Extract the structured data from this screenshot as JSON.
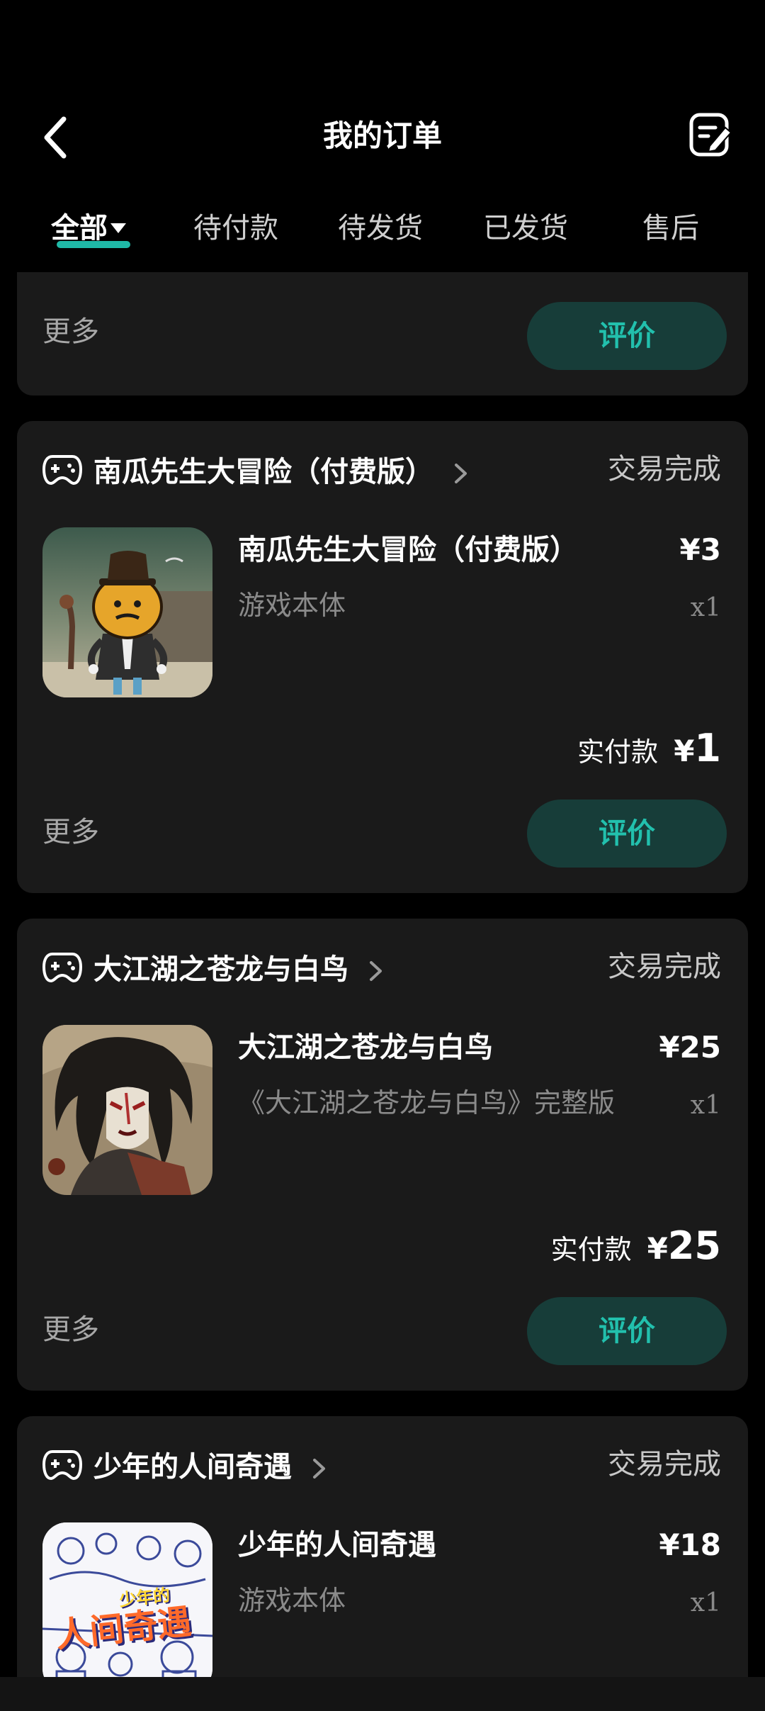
{
  "header": {
    "title": "我的订单"
  },
  "tabs": [
    {
      "label": "全部",
      "active": true
    },
    {
      "label": "待付款"
    },
    {
      "label": "待发货"
    },
    {
      "label": "已发货"
    },
    {
      "label": "售后"
    }
  ],
  "common": {
    "more_label": "更多",
    "review_label": "评价",
    "paid_label": "实付款",
    "currency": "¥"
  },
  "orders": [
    {
      "store_name": "南瓜先生大冒险（付费版）",
      "status": "交易完成",
      "item": {
        "title": "南瓜先生大冒险（付费版）",
        "sku": "游戏本体",
        "price": "¥3",
        "qty": "x1"
      },
      "paid_amount": "1"
    },
    {
      "store_name": "大江湖之苍龙与白鸟",
      "status": "交易完成",
      "item": {
        "title": "大江湖之苍龙与白鸟",
        "sku": "《大江湖之苍龙与白鸟》完整版",
        "price": "¥25",
        "qty": "x1"
      },
      "paid_amount": "25"
    },
    {
      "store_name": "少年的人间奇遇",
      "status": "交易完成",
      "item": {
        "title": "少年的人间奇遇",
        "sku": "游戏本体",
        "price": "¥18",
        "qty": "x1"
      }
    }
  ],
  "thumbnails": {
    "order3_logo_top": "少年的",
    "order3_logo_main": "人间奇遇"
  },
  "colors": {
    "accent": "#1fb9a7",
    "review_button_bg": "#173d39",
    "card_bg": "#1a1a1a"
  }
}
